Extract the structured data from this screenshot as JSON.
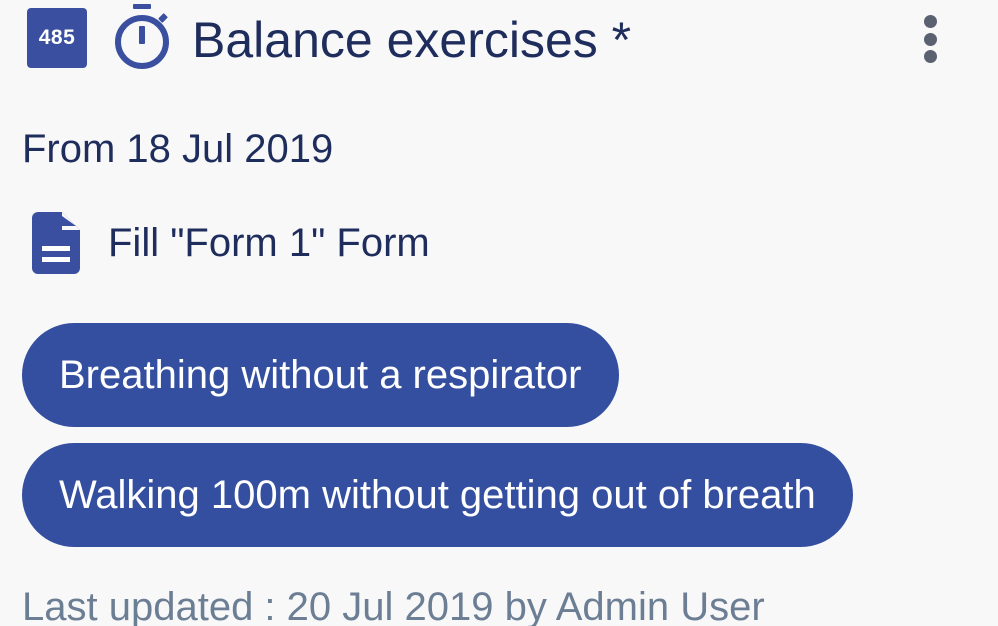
{
  "header": {
    "badge": "485",
    "title": "Balance exercises *",
    "timer_icon": "stopwatch-icon",
    "menu_icon": "more-vertical-icon"
  },
  "schedule": {
    "from": "From 18 Jul 2019"
  },
  "form": {
    "icon": "document-icon",
    "label": "Fill \"Form 1\" Form"
  },
  "goals": [
    {
      "label": "Breathing without a respirator"
    },
    {
      "label": "Walking 100m without getting out of breath"
    }
  ],
  "footer": {
    "last_updated": "Last updated : 20 Jul 2019 by Admin User"
  },
  "colors": {
    "accent": "#354fa0",
    "title_text": "#1f2d5c",
    "muted_text": "#6c7e94",
    "background": "#f8f8f9"
  }
}
